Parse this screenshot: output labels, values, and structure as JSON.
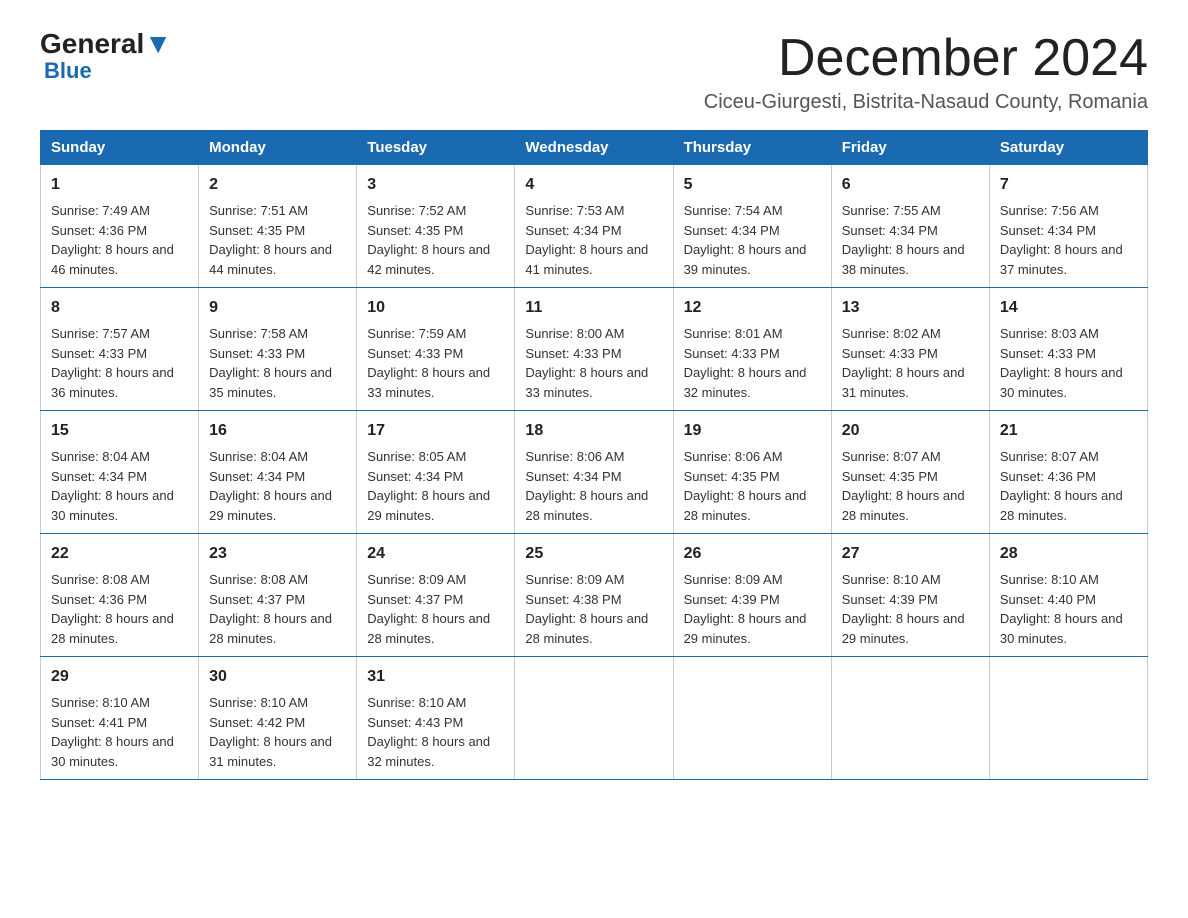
{
  "header": {
    "logo_general": "General",
    "logo_blue": "Blue",
    "month_title": "December 2024",
    "location": "Ciceu-Giurgesti, Bistrita-Nasaud County, Romania"
  },
  "days_of_week": [
    "Sunday",
    "Monday",
    "Tuesday",
    "Wednesday",
    "Thursday",
    "Friday",
    "Saturday"
  ],
  "weeks": [
    [
      {
        "day": "1",
        "sunrise": "7:49 AM",
        "sunset": "4:36 PM",
        "daylight": "8 hours and 46 minutes."
      },
      {
        "day": "2",
        "sunrise": "7:51 AM",
        "sunset": "4:35 PM",
        "daylight": "8 hours and 44 minutes."
      },
      {
        "day": "3",
        "sunrise": "7:52 AM",
        "sunset": "4:35 PM",
        "daylight": "8 hours and 42 minutes."
      },
      {
        "day": "4",
        "sunrise": "7:53 AM",
        "sunset": "4:34 PM",
        "daylight": "8 hours and 41 minutes."
      },
      {
        "day": "5",
        "sunrise": "7:54 AM",
        "sunset": "4:34 PM",
        "daylight": "8 hours and 39 minutes."
      },
      {
        "day": "6",
        "sunrise": "7:55 AM",
        "sunset": "4:34 PM",
        "daylight": "8 hours and 38 minutes."
      },
      {
        "day": "7",
        "sunrise": "7:56 AM",
        "sunset": "4:34 PM",
        "daylight": "8 hours and 37 minutes."
      }
    ],
    [
      {
        "day": "8",
        "sunrise": "7:57 AM",
        "sunset": "4:33 PM",
        "daylight": "8 hours and 36 minutes."
      },
      {
        "day": "9",
        "sunrise": "7:58 AM",
        "sunset": "4:33 PM",
        "daylight": "8 hours and 35 minutes."
      },
      {
        "day": "10",
        "sunrise": "7:59 AM",
        "sunset": "4:33 PM",
        "daylight": "8 hours and 33 minutes."
      },
      {
        "day": "11",
        "sunrise": "8:00 AM",
        "sunset": "4:33 PM",
        "daylight": "8 hours and 33 minutes."
      },
      {
        "day": "12",
        "sunrise": "8:01 AM",
        "sunset": "4:33 PM",
        "daylight": "8 hours and 32 minutes."
      },
      {
        "day": "13",
        "sunrise": "8:02 AM",
        "sunset": "4:33 PM",
        "daylight": "8 hours and 31 minutes."
      },
      {
        "day": "14",
        "sunrise": "8:03 AM",
        "sunset": "4:33 PM",
        "daylight": "8 hours and 30 minutes."
      }
    ],
    [
      {
        "day": "15",
        "sunrise": "8:04 AM",
        "sunset": "4:34 PM",
        "daylight": "8 hours and 30 minutes."
      },
      {
        "day": "16",
        "sunrise": "8:04 AM",
        "sunset": "4:34 PM",
        "daylight": "8 hours and 29 minutes."
      },
      {
        "day": "17",
        "sunrise": "8:05 AM",
        "sunset": "4:34 PM",
        "daylight": "8 hours and 29 minutes."
      },
      {
        "day": "18",
        "sunrise": "8:06 AM",
        "sunset": "4:34 PM",
        "daylight": "8 hours and 28 minutes."
      },
      {
        "day": "19",
        "sunrise": "8:06 AM",
        "sunset": "4:35 PM",
        "daylight": "8 hours and 28 minutes."
      },
      {
        "day": "20",
        "sunrise": "8:07 AM",
        "sunset": "4:35 PM",
        "daylight": "8 hours and 28 minutes."
      },
      {
        "day": "21",
        "sunrise": "8:07 AM",
        "sunset": "4:36 PM",
        "daylight": "8 hours and 28 minutes."
      }
    ],
    [
      {
        "day": "22",
        "sunrise": "8:08 AM",
        "sunset": "4:36 PM",
        "daylight": "8 hours and 28 minutes."
      },
      {
        "day": "23",
        "sunrise": "8:08 AM",
        "sunset": "4:37 PM",
        "daylight": "8 hours and 28 minutes."
      },
      {
        "day": "24",
        "sunrise": "8:09 AM",
        "sunset": "4:37 PM",
        "daylight": "8 hours and 28 minutes."
      },
      {
        "day": "25",
        "sunrise": "8:09 AM",
        "sunset": "4:38 PM",
        "daylight": "8 hours and 28 minutes."
      },
      {
        "day": "26",
        "sunrise": "8:09 AM",
        "sunset": "4:39 PM",
        "daylight": "8 hours and 29 minutes."
      },
      {
        "day": "27",
        "sunrise": "8:10 AM",
        "sunset": "4:39 PM",
        "daylight": "8 hours and 29 minutes."
      },
      {
        "day": "28",
        "sunrise": "8:10 AM",
        "sunset": "4:40 PM",
        "daylight": "8 hours and 30 minutes."
      }
    ],
    [
      {
        "day": "29",
        "sunrise": "8:10 AM",
        "sunset": "4:41 PM",
        "daylight": "8 hours and 30 minutes."
      },
      {
        "day": "30",
        "sunrise": "8:10 AM",
        "sunset": "4:42 PM",
        "daylight": "8 hours and 31 minutes."
      },
      {
        "day": "31",
        "sunrise": "8:10 AM",
        "sunset": "4:43 PM",
        "daylight": "8 hours and 32 minutes."
      },
      null,
      null,
      null,
      null
    ]
  ]
}
